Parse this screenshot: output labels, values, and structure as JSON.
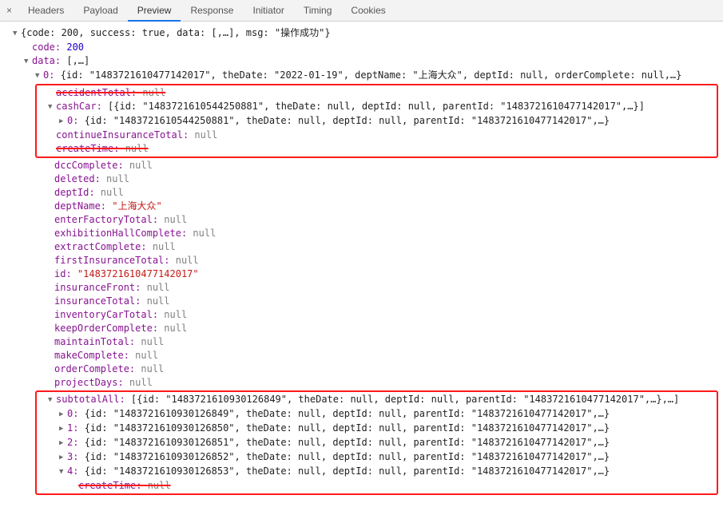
{
  "tabs": {
    "close": "×",
    "headers": "Headers",
    "payload": "Payload",
    "preview": "Preview",
    "response": "Response",
    "initiator": "Initiator",
    "timing": "Timing",
    "cookies": "Cookies"
  },
  "root_summary": "{code: 200, success: true, data: [,…], msg: \"操作成功\"}",
  "code_line": {
    "key": "code: ",
    "val": "200"
  },
  "data_line": {
    "key": "data: ",
    "val": "[,…]"
  },
  "item0_summary_prefix": "0: ",
  "item0_summary": "{id: \"1483721610477142017\", theDate: \"2022-01-19\", deptName: \"上海大众\", deptId: null, orderComplete: null,…}",
  "accidentTotal": {
    "key": "accidentTotal: ",
    "val": "null"
  },
  "cashCar_key": "cashCar: ",
  "cashCar_summary": "[{id: \"1483721610544250881\", theDate: null, deptId: null, parentId: \"1483721610477142017\",…}]",
  "cashCar_0_prefix": "0: ",
  "cashCar_0": "{id: \"1483721610544250881\", theDate: null, deptId: null, parentId: \"1483721610477142017\",…}",
  "continueInsuranceTotal": {
    "key": "continueInsuranceTotal: ",
    "val": "null"
  },
  "createTime": {
    "key": "createTime: ",
    "val": "null"
  },
  "dccComplete": {
    "key": "dccComplete: ",
    "val": "null"
  },
  "deleted": {
    "key": "deleted: ",
    "val": "null"
  },
  "deptId": {
    "key": "deptId: ",
    "val": "null"
  },
  "deptName": {
    "key": "deptName: ",
    "val": "\"上海大众\""
  },
  "enterFactoryTotal": {
    "key": "enterFactoryTotal: ",
    "val": "null"
  },
  "exhibitionHallComplete": {
    "key": "exhibitionHallComplete: ",
    "val": "null"
  },
  "extractComplete": {
    "key": "extractComplete: ",
    "val": "null"
  },
  "firstInsuranceTotal": {
    "key": "firstInsuranceTotal: ",
    "val": "null"
  },
  "id": {
    "key": "id: ",
    "val": "\"1483721610477142017\""
  },
  "insuranceFront": {
    "key": "insuranceFront: ",
    "val": "null"
  },
  "insuranceTotal": {
    "key": "insuranceTotal: ",
    "val": "null"
  },
  "inventoryCarTotal": {
    "key": "inventoryCarTotal: ",
    "val": "null"
  },
  "keepOrderComplete": {
    "key": "keepOrderComplete: ",
    "val": "null"
  },
  "maintainTotal": {
    "key": "maintainTotal: ",
    "val": "null"
  },
  "makeComplete": {
    "key": "makeComplete: ",
    "val": "null"
  },
  "orderComplete": {
    "key": "orderComplete: ",
    "val": "null"
  },
  "projectDays": {
    "key": "projectDays: ",
    "val": "null"
  },
  "subtotalAll_key": "subtotalAll: ",
  "subtotalAll_summary": "[{id: \"1483721610930126849\", theDate: null, deptId: null, parentId: \"1483721610477142017\",…},…]",
  "sub0p": "0: ",
  "sub0": "{id: \"1483721610930126849\", theDate: null, deptId: null, parentId: \"1483721610477142017\",…}",
  "sub1p": "1: ",
  "sub1": "{id: \"1483721610930126850\", theDate: null, deptId: null, parentId: \"1483721610477142017\",…}",
  "sub2p": "2: ",
  "sub2": "{id: \"1483721610930126851\", theDate: null, deptId: null, parentId: \"1483721610477142017\",…}",
  "sub3p": "3: ",
  "sub3": "{id: \"1483721610930126852\", theDate: null, deptId: null, parentId: \"1483721610477142017\",…}",
  "sub4p": "4: ",
  "sub4": "{id: \"1483721610930126853\", theDate: null, deptId: null, parentId: \"1483721610477142017\",…}",
  "createTime2": {
    "key": "createTime: ",
    "val": "null"
  }
}
